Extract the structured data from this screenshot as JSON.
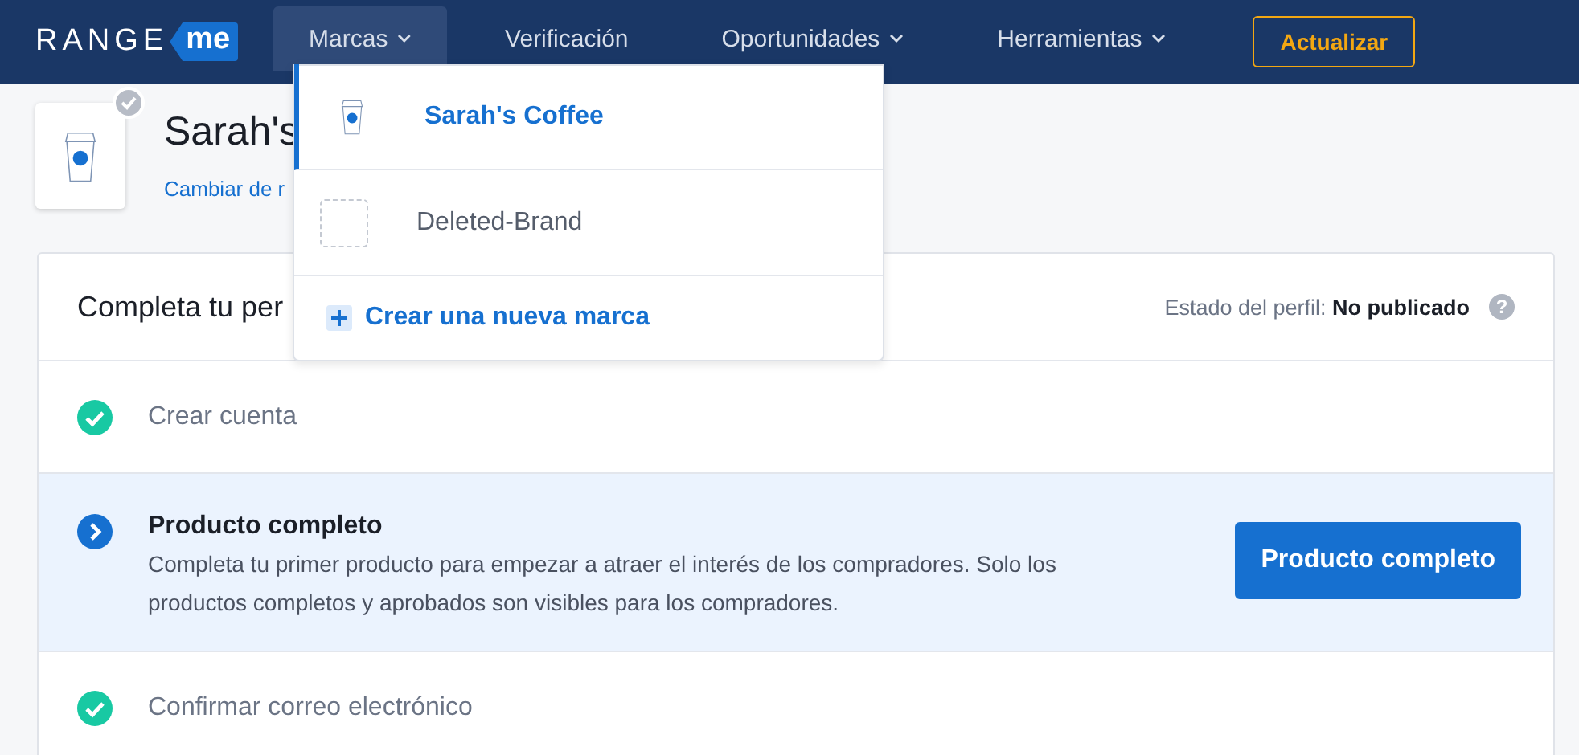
{
  "nav": {
    "logo": {
      "word": "RANGE",
      "tag": "me"
    },
    "items": [
      {
        "label": "Marcas",
        "selected": true,
        "dropdown": true
      },
      {
        "label": "Verificación",
        "selected": false,
        "dropdown": false
      },
      {
        "label": "Oportunidades",
        "selected": false,
        "dropdown": true
      },
      {
        "label": "Herramientas",
        "selected": false,
        "dropdown": true
      }
    ],
    "upgrade_button": "Actualizar"
  },
  "brand": {
    "name": "Sarah's",
    "change_link": "Cambiar de r"
  },
  "brand_menu": {
    "items": [
      {
        "label": "Sarah's Coffee",
        "selected": true,
        "kind": "logo"
      },
      {
        "label": "Deleted-Brand",
        "selected": false,
        "kind": "empty"
      }
    ],
    "create": "Crear una nueva marca"
  },
  "profile_card": {
    "title": "Completa tu per",
    "status_label": "Estado del perfil:",
    "status_value": "No publicado",
    "help_icon": "?",
    "steps": [
      {
        "title": "Crear cuenta",
        "done": true
      },
      {
        "title": "Producto completo",
        "done": false,
        "description": "Completa tu primer producto para empezar a atraer el interés de los compradores. Solo los productos completos y aprobados son visibles para los compradores.",
        "button": "Producto completo"
      },
      {
        "title": "Confirmar correo electrónico",
        "done": true
      }
    ]
  }
}
